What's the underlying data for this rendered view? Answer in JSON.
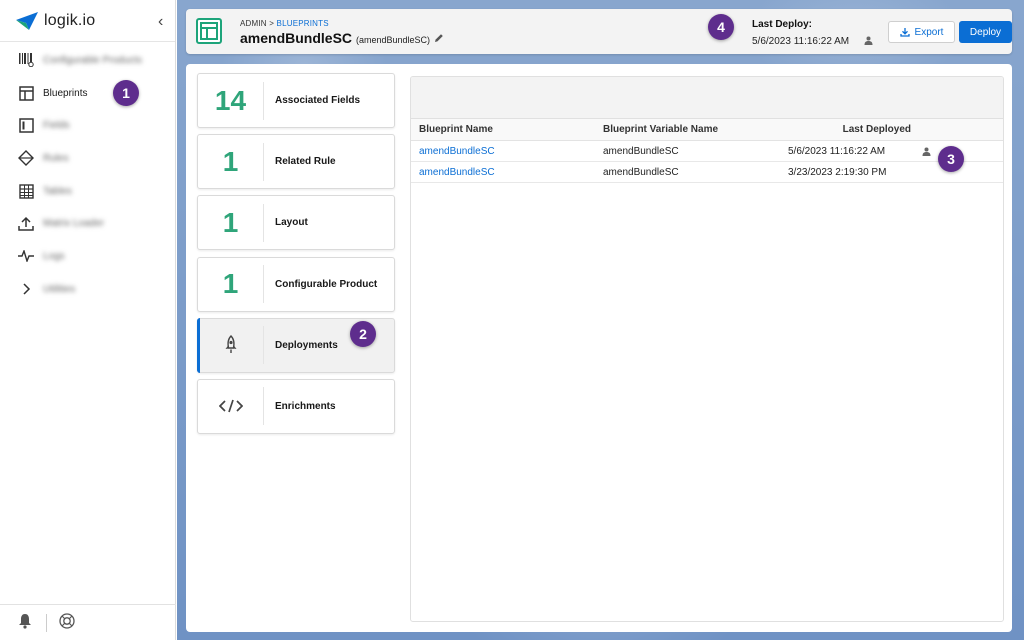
{
  "app": {
    "name": "logik.io"
  },
  "sidebar": {
    "items": [
      {
        "label": "Configurable Products",
        "icon": "barcode-icon",
        "blurred": true
      },
      {
        "label": "Blueprints",
        "icon": "blueprint-icon",
        "blurred": false
      },
      {
        "label": "Fields",
        "icon": "field-icon",
        "blurred": true
      },
      {
        "label": "Rules",
        "icon": "rules-icon",
        "blurred": true
      },
      {
        "label": "Tables",
        "icon": "table-icon",
        "blurred": true
      },
      {
        "label": "Matrix Loader",
        "icon": "upload-icon",
        "blurred": true
      },
      {
        "label": "Logs",
        "icon": "pulse-icon",
        "blurred": true
      },
      {
        "label": "Utilities",
        "icon": "chevron-right-icon",
        "blurred": true
      }
    ]
  },
  "header": {
    "breadcrumb_root": "ADMIN",
    "breadcrumb_sep": ">",
    "breadcrumb_link": "BLUEPRINTS",
    "title": "amendBundleSC",
    "subtitle": "(amendBundleSC)",
    "last_deploy_label": "Last Deploy:",
    "last_deploy_time": "5/6/2023 11:16:22 AM",
    "export_label": "Export",
    "deploy_label": "Deploy"
  },
  "cards": [
    {
      "count": "14",
      "label": "Associated Fields"
    },
    {
      "count": "1",
      "label": "Related Rule"
    },
    {
      "count": "1",
      "label": "Layout"
    },
    {
      "count": "1",
      "label": "Configurable Product"
    },
    {
      "label": "Deployments",
      "icon": "rocket-icon",
      "active": true
    },
    {
      "label": "Enrichments",
      "icon": "code-icon"
    }
  ],
  "table": {
    "columns": [
      "Blueprint Name",
      "Blueprint Variable Name",
      "Last Deployed"
    ],
    "rows": [
      {
        "name": "amendBundleSC",
        "variable": "amendBundleSC",
        "deployed": "5/6/2023 11:16:22 AM",
        "user_icon": true
      },
      {
        "name": "amendBundleSC",
        "variable": "amendBundleSC",
        "deployed": "3/23/2023 2:19:30 PM",
        "user_icon": false
      }
    ]
  },
  "callouts": [
    "1",
    "2",
    "3",
    "4"
  ],
  "colors": {
    "accent": "#0b6ed4",
    "count_green": "#2fa57a",
    "callout": "#5e2d8d"
  }
}
